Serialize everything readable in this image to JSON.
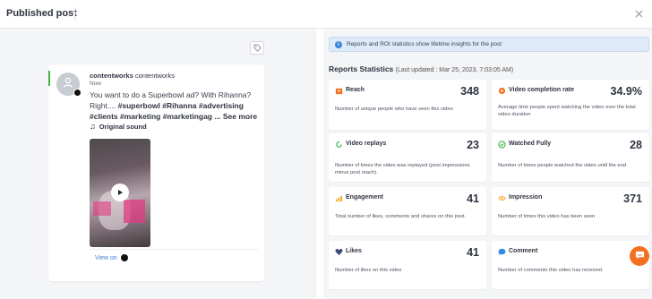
{
  "header": {
    "title": "Published post"
  },
  "post": {
    "username": "contentworks",
    "handle": "contentworks",
    "time": "Now",
    "text": "You want to do a Superbowl ad? With Rihanna? Right.... ",
    "hashtags": "#superbowl #Rihanna #advertising #clients #marketing #marketingag",
    "see_more": "... See more",
    "sound": "Original sound",
    "view_on": "View on"
  },
  "banner": {
    "text": "Reports and ROI statistics show lifetime insights for the post"
  },
  "stats": {
    "title": "Reports Statistics",
    "updated": "(Last updated : Mar 25, 2023, 7:03:05 AM)",
    "cards": [
      {
        "label": "Reach",
        "value": "348",
        "desc": "Number of unique people who have seen this video"
      },
      {
        "label": "Video completion rate",
        "value": "34.9%",
        "desc": "Average time people spent watching the video over the total video duration"
      },
      {
        "label": "Video replays",
        "value": "23",
        "desc": "Number of times the video was replayed (post impressions minus post reach)."
      },
      {
        "label": "Watched Fully",
        "value": "28",
        "desc": "Number of times people watched the video until the end"
      },
      {
        "label": "Engagement",
        "value": "41",
        "desc": "Total number of likes, comments and shares on this post."
      },
      {
        "label": "Impression",
        "value": "371",
        "desc": "Number of times this video has been seen"
      },
      {
        "label": "Likes",
        "value": "41",
        "desc": "Number of likes on this video"
      },
      {
        "label": "Comment",
        "value": "0",
        "desc": "Number of comments this video has received."
      }
    ]
  },
  "colors": {
    "accent": "#f37021",
    "link": "#3f7fd6",
    "info_bg": "#dfeaf8",
    "success": "#41b649"
  },
  "icons": [
    "close-icon",
    "tag-icon",
    "user-icon",
    "tiktok-icon",
    "music-note-icon",
    "play-icon",
    "info-icon",
    "reach-icon",
    "completion-icon",
    "replay-icon",
    "watched-icon",
    "engagement-icon",
    "impression-icon",
    "heart-icon",
    "comment-icon",
    "chat-icon"
  ]
}
